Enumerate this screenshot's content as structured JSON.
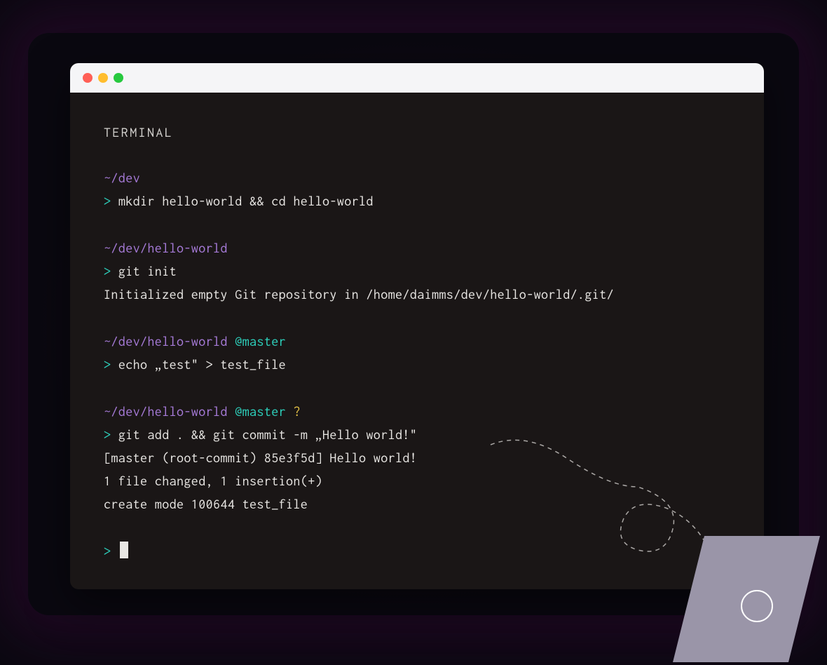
{
  "title": "TERMINAL",
  "traffic_lights": {
    "red": "close-icon",
    "yellow": "minimize-icon",
    "green": "maximize-icon"
  },
  "blocks": [
    {
      "path": "~/dev",
      "branch": "",
      "status": "",
      "prompt": ">",
      "command": "mkdir hello-world && cd hello-world",
      "output": []
    },
    {
      "path": "~/dev/hello-world",
      "branch": "",
      "status": "",
      "prompt": ">",
      "command": "git init",
      "output": [
        "Initialized empty Git repository in /home/daimms/dev/hello-world/.git/"
      ]
    },
    {
      "path": "~/dev/hello-world",
      "branch": "@master",
      "status": "",
      "prompt": ">",
      "command": "echo „test\" > test_file",
      "output": []
    },
    {
      "path": "~/dev/hello-world",
      "branch": "@master",
      "status": "?",
      "prompt": ">",
      "command": "git add . && git commit -m „Hello world!\"",
      "output": [
        "[master (root-commit) 85e3f5d] Hello world!",
        "1 file changed, 1 insertion(+)",
        "create mode 100644 test_file"
      ]
    }
  ],
  "final_prompt": ">"
}
